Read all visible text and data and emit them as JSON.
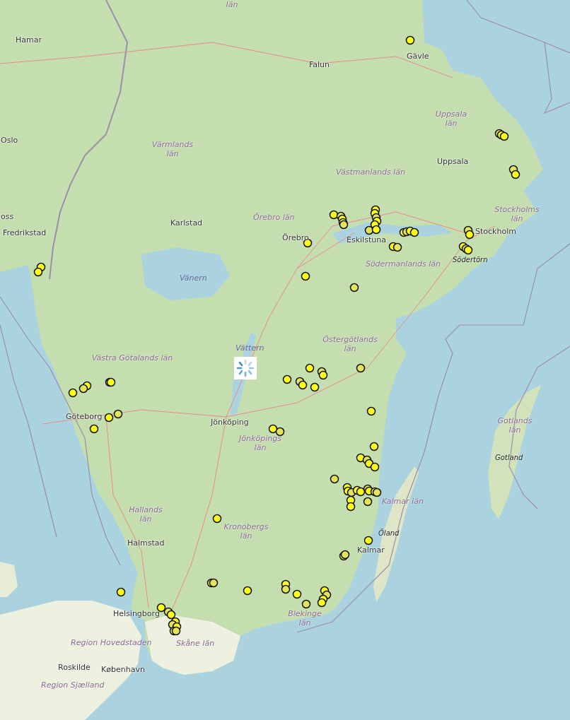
{
  "map": {
    "labels": [
      {
        "text": "län",
        "kind": "region"
      },
      {
        "text": "Hamar",
        "kind": "city"
      },
      {
        "text": "Oslo",
        "kind": "city"
      },
      {
        "text": "oss",
        "kind": "city"
      },
      {
        "text": "Fredrikstad",
        "kind": "city"
      },
      {
        "text": "Värmlands län",
        "kind": "region"
      },
      {
        "text": "Karlstad",
        "kind": "city"
      },
      {
        "text": "Vänern",
        "kind": "water"
      },
      {
        "text": "Falun",
        "kind": "city"
      },
      {
        "text": "Gävle",
        "kind": "city"
      },
      {
        "text": "Uppsala län",
        "kind": "region"
      },
      {
        "text": "Uppsala",
        "kind": "city"
      },
      {
        "text": "Västmanlands län",
        "kind": "region"
      },
      {
        "text": "Örebro län",
        "kind": "region"
      },
      {
        "text": "Örebro",
        "kind": "city"
      },
      {
        "text": "Eskilstuna",
        "kind": "city"
      },
      {
        "text": "Stockholms län",
        "kind": "region"
      },
      {
        "text": "Stockholm",
        "kind": "city"
      },
      {
        "text": "Södertörn",
        "kind": "island"
      },
      {
        "text": "Södermanlands län",
        "kind": "region"
      },
      {
        "text": "Vättern",
        "kind": "water"
      },
      {
        "text": "Östergötlands län",
        "kind": "region"
      },
      {
        "text": "Västra Götalands län",
        "kind": "region"
      },
      {
        "text": "Göteborg",
        "kind": "city"
      },
      {
        "text": "Jönköping",
        "kind": "city"
      },
      {
        "text": "Jönköpings län",
        "kind": "region"
      },
      {
        "text": "Gotlands län",
        "kind": "region"
      },
      {
        "text": "Gotland",
        "kind": "island"
      },
      {
        "text": "Hallands län",
        "kind": "region"
      },
      {
        "text": "Kalmar län",
        "kind": "region"
      },
      {
        "text": "Kronobergs län",
        "kind": "region"
      },
      {
        "text": "Öland",
        "kind": "island"
      },
      {
        "text": "Kalmar",
        "kind": "city"
      },
      {
        "text": "Halmstad",
        "kind": "city"
      },
      {
        "text": "Helsingborg",
        "kind": "city"
      },
      {
        "text": "Blekinge län",
        "kind": "region"
      },
      {
        "text": "Region Hovedstaden",
        "kind": "region"
      },
      {
        "text": "Skåne län",
        "kind": "region"
      },
      {
        "text": "Roskilde",
        "kind": "city"
      },
      {
        "text": "København",
        "kind": "city"
      },
      {
        "text": "Region Sjælland",
        "kind": "region"
      }
    ]
  }
}
